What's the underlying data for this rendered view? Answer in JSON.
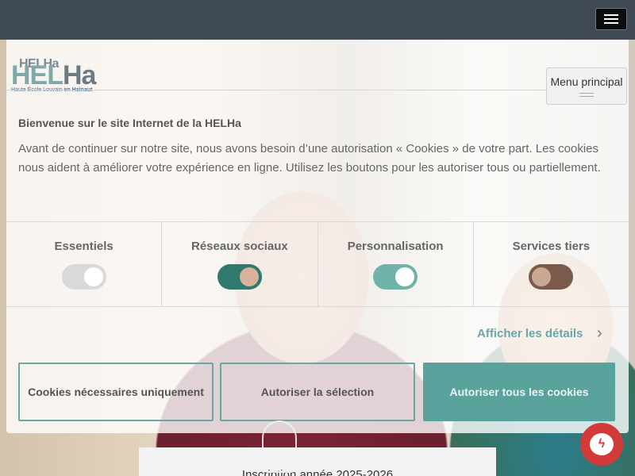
{
  "header": {
    "menu_button_icon": "hamburger-icon"
  },
  "logo": {
    "small": "HELHa",
    "big_a": "HEL",
    "big_b": "Ha",
    "sub_a": "Haute École Louvain ",
    "sub_b": "en Hainaut"
  },
  "menu": {
    "label": "Menu principal"
  },
  "consent": {
    "title": "Bienvenue sur le site Internet de la HELHa",
    "text": "Avant de continuer sur notre site, nous avons besoin d’une autorisation « Cookies » de votre part. Les cookies nous aident à améliorer votre expérience en ligne. Utilisez les boutons pour les autoriser tous ou partiellement.",
    "categories": [
      {
        "label": "Essentiels",
        "state": "on-disabled",
        "track": "#d9d9d9",
        "knob_side": "right"
      },
      {
        "label": "Réseaux sociaux",
        "state": "on",
        "track": "#2f7a6c",
        "knob_side": "right"
      },
      {
        "label": "Personnalisation",
        "state": "on",
        "track": "#6fb3aa",
        "knob_side": "right"
      },
      {
        "label": "Services tiers",
        "state": "off",
        "track": "#7a5a4a",
        "knob_side": "left"
      }
    ],
    "details_link": "Afficher les détails",
    "buttons": {
      "necessary": "Cookies nécessaires uniquement",
      "selection": "Autoriser la sélection",
      "all": "Autoriser tous les cookies"
    }
  },
  "banner": {
    "inscription": "Inscription année 2025-2026"
  },
  "colors": {
    "accent": "#6aa8a6",
    "topbar": "#3f4a55",
    "messenger": "#d23b3a"
  }
}
